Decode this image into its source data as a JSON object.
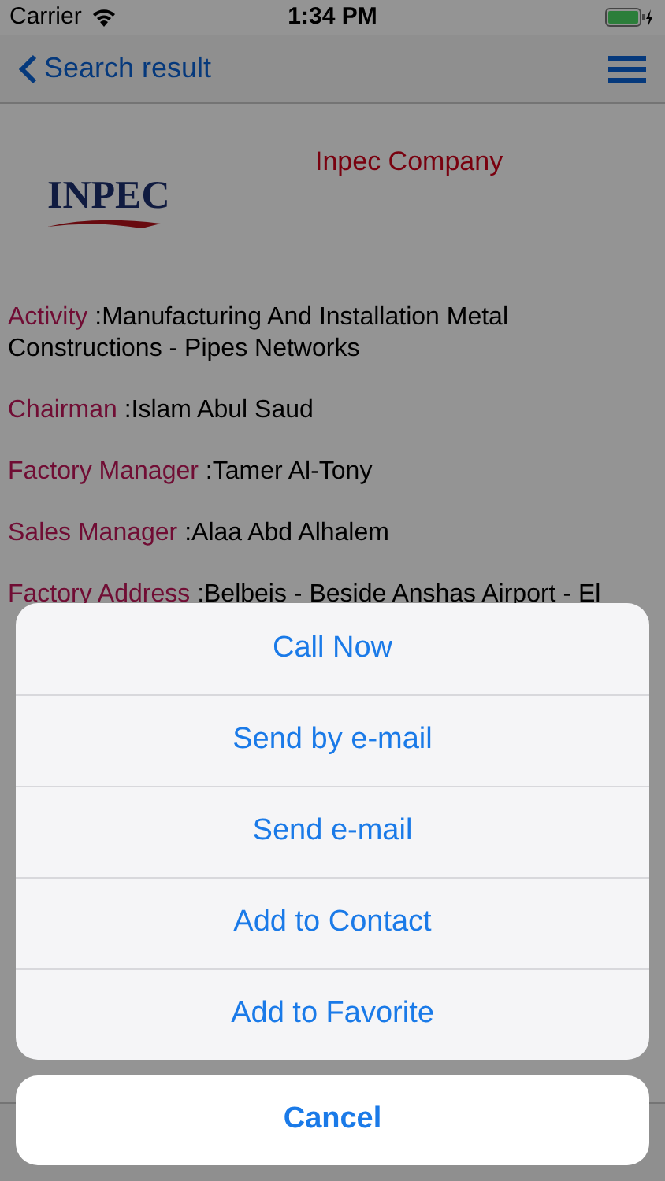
{
  "status_bar": {
    "carrier": "Carrier",
    "time": "1:34 PM"
  },
  "nav": {
    "back": "Search result"
  },
  "company": {
    "logo": "INPEC",
    "name": "Inpec Company"
  },
  "fields": [
    {
      "label": "Activity",
      "value": ":Manufacturing And Installation Metal Constructions - Pipes Networks"
    },
    {
      "label": "Chairman",
      "value": ":Islam Abul Saud"
    },
    {
      "label": "Factory Manager",
      "value": ":Tamer Al-Tony"
    },
    {
      "label": "Sales Manager",
      "value": ":Alaa Abd Alhalem"
    },
    {
      "label": "Factory Address",
      "value": ":Belbeis - Beside Anshas Airport - El"
    }
  ],
  "action_sheet": {
    "actions": [
      "Call Now",
      "Send by e-mail",
      "Send e-mail",
      "Add to Contact",
      "Add to Favorite"
    ],
    "cancel": "Cancel"
  }
}
